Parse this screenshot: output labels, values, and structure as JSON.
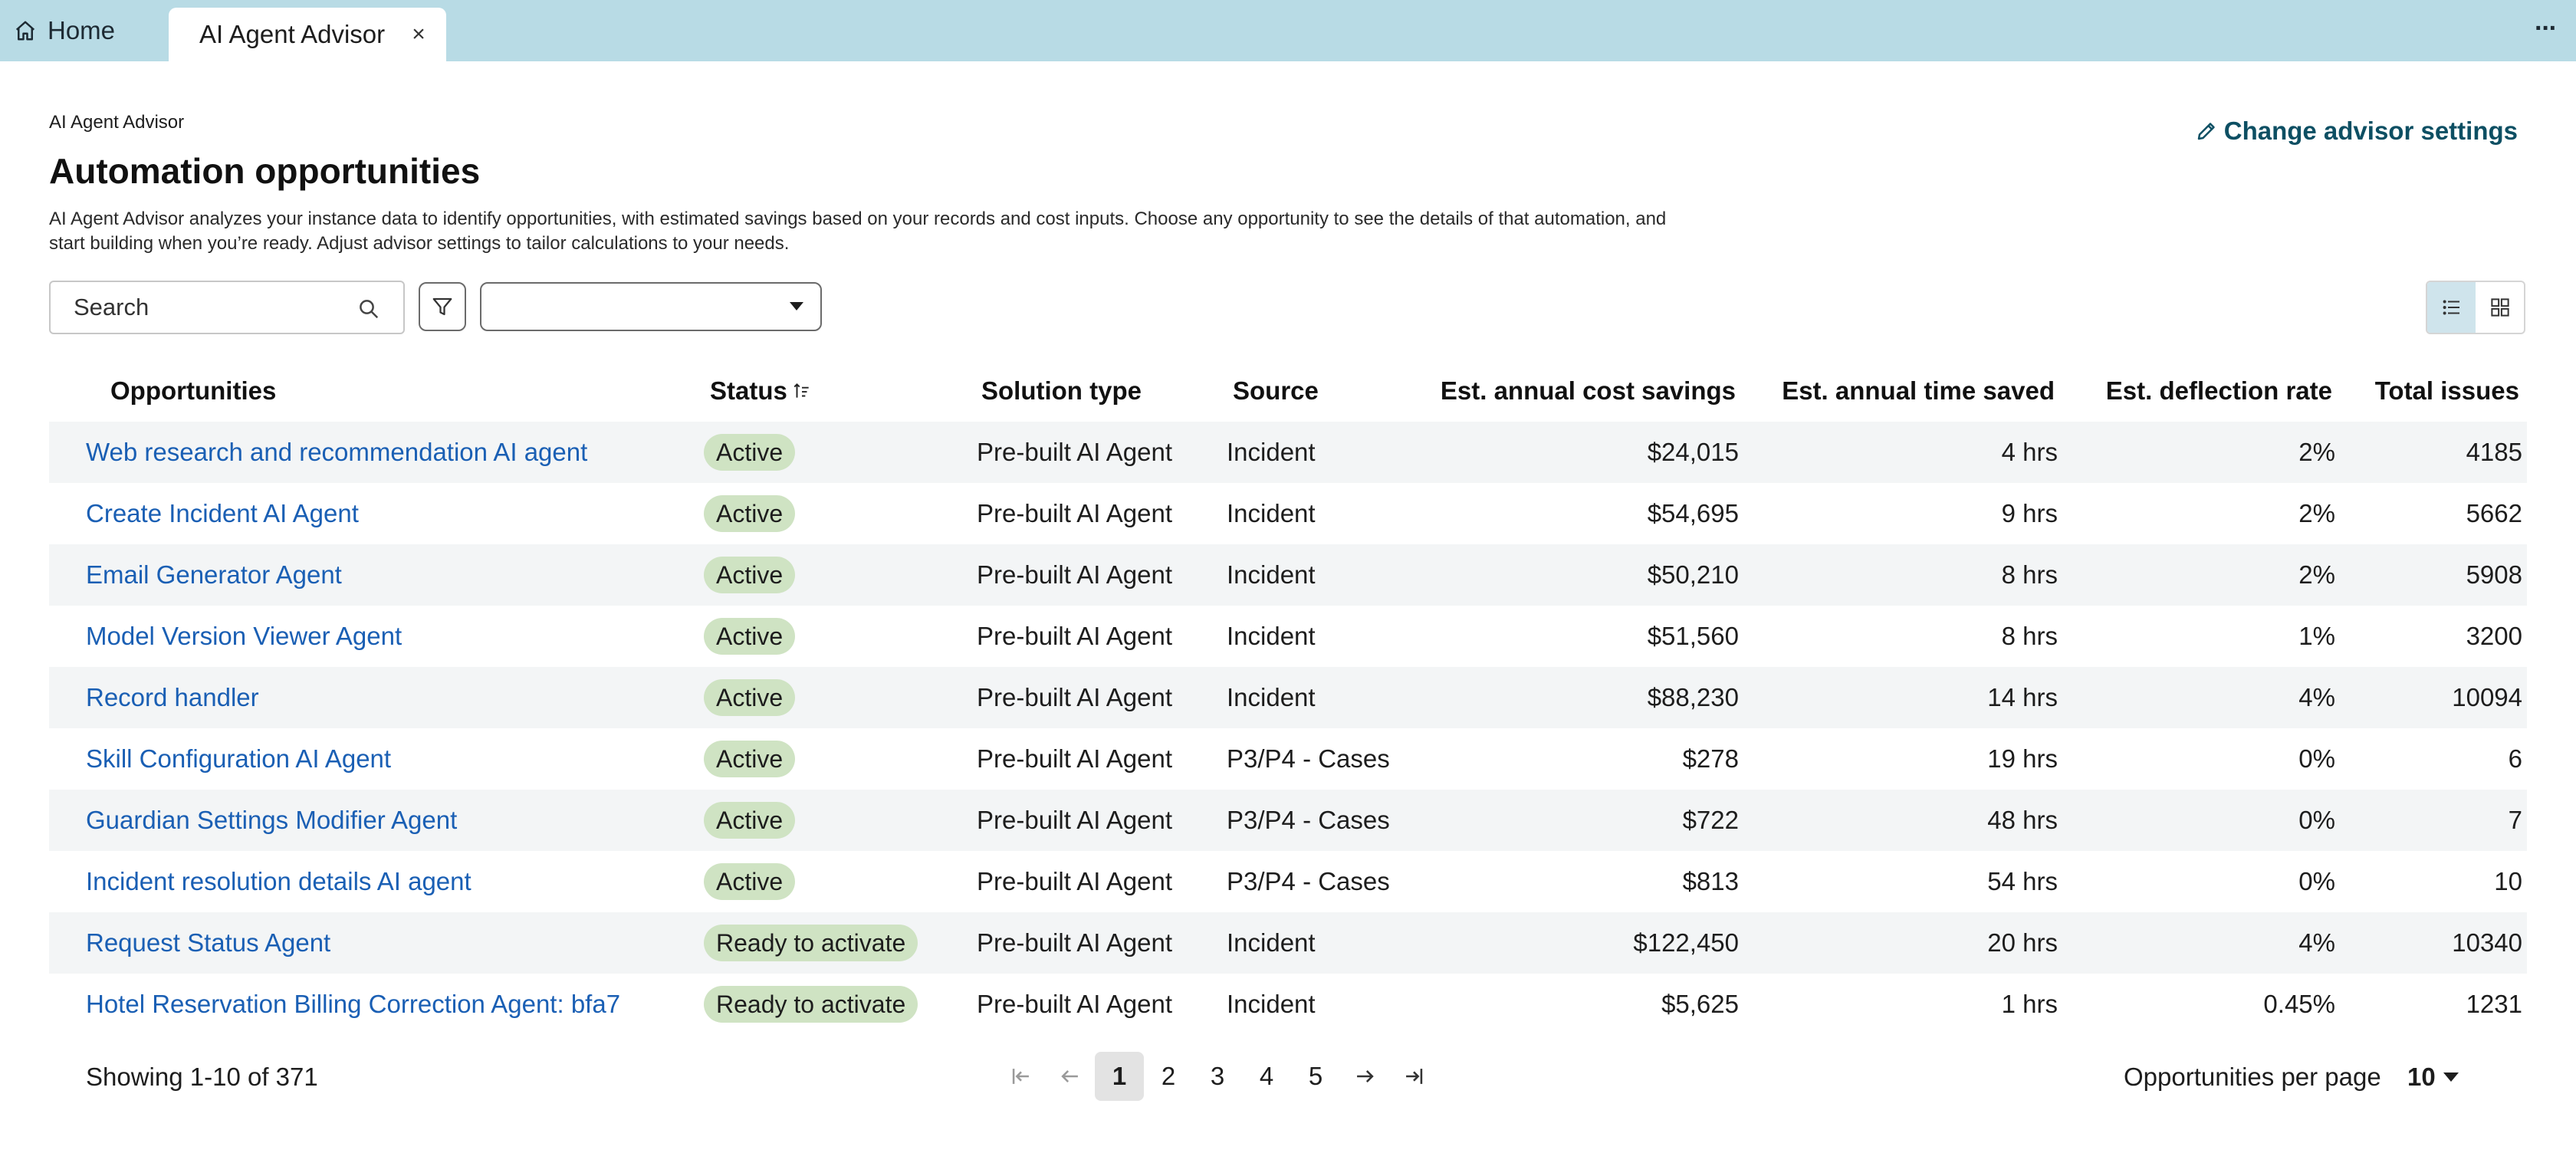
{
  "tabs": {
    "home_label": "Home",
    "active_label": "AI Agent Advisor"
  },
  "header": {
    "breadcrumb": "AI Agent Advisor",
    "title": "Automation opportunities",
    "description": "AI Agent Advisor analyzes your instance data to identify opportunities, with estimated savings based on your records and cost inputs. Choose any opportunity to see the details of that automation, and start building when you’re ready. Adjust advisor settings to tailor calculations to your needs.",
    "settings_link": "Change advisor settings"
  },
  "toolbar": {
    "search_placeholder": "Search",
    "select_value": ""
  },
  "table": {
    "columns": {
      "opportunities": "Opportunities",
      "status": "Status",
      "solution_type": "Solution type",
      "source": "Source",
      "cost_savings": "Est. annual cost savings",
      "time_saved": "Est. annual time saved",
      "deflection_rate": "Est. deflection rate",
      "total_issues": "Total issues"
    },
    "rows": [
      {
        "name": "Web research and recommendation AI agent",
        "status": "Active",
        "solution": "Pre-built AI Agent",
        "source": "Incident",
        "cost": "$24,015",
        "time": "4 hrs",
        "deflection": "2%",
        "issues": "4185"
      },
      {
        "name": "Create Incident AI Agent",
        "status": "Active",
        "solution": "Pre-built AI Agent",
        "source": "Incident",
        "cost": "$54,695",
        "time": "9 hrs",
        "deflection": "2%",
        "issues": "5662"
      },
      {
        "name": "Email Generator Agent",
        "status": "Active",
        "solution": "Pre-built AI Agent",
        "source": "Incident",
        "cost": "$50,210",
        "time": "8 hrs",
        "deflection": "2%",
        "issues": "5908"
      },
      {
        "name": "Model Version Viewer Agent",
        "status": "Active",
        "solution": "Pre-built AI Agent",
        "source": "Incident",
        "cost": "$51,560",
        "time": "8 hrs",
        "deflection": "1%",
        "issues": "3200"
      },
      {
        "name": "Record handler",
        "status": "Active",
        "solution": "Pre-built AI Agent",
        "source": "Incident",
        "cost": "$88,230",
        "time": "14 hrs",
        "deflection": "4%",
        "issues": "10094"
      },
      {
        "name": "Skill Configuration AI Agent",
        "status": "Active",
        "solution": "Pre-built AI Agent",
        "source": "P3/P4 - Cases",
        "cost": "$278",
        "time": "19 hrs",
        "deflection": "0%",
        "issues": "6"
      },
      {
        "name": "Guardian Settings Modifier Agent",
        "status": "Active",
        "solution": "Pre-built AI Agent",
        "source": "P3/P4 - Cases",
        "cost": "$722",
        "time": "48 hrs",
        "deflection": "0%",
        "issues": "7"
      },
      {
        "name": "Incident resolution details AI agent",
        "status": "Active",
        "solution": "Pre-built AI Agent",
        "source": "P3/P4 - Cases",
        "cost": "$813",
        "time": "54 hrs",
        "deflection": "0%",
        "issues": "10"
      },
      {
        "name": "Request Status Agent",
        "status": "Ready to activate",
        "solution": "Pre-built AI Agent",
        "source": "Incident",
        "cost": "$122,450",
        "time": "20 hrs",
        "deflection": "4%",
        "issues": "10340"
      },
      {
        "name": "Hotel Reservation Billing Correction Agent: bfa7",
        "status": "Ready to activate",
        "solution": "Pre-built AI Agent",
        "source": "Incident",
        "cost": "$5,625",
        "time": "1 hrs",
        "deflection": "0.45%",
        "issues": "1231"
      }
    ]
  },
  "footer": {
    "showing": "Showing 1-10 of 371",
    "pages": [
      "1",
      "2",
      "3",
      "4",
      "5"
    ],
    "current_page": "1",
    "per_page_label": "Opportunities per page",
    "per_page_value": "10"
  },
  "colors": {
    "tabbar": "#b8dbe5",
    "link": "#1a5fb4",
    "settings_link": "#0d4f63",
    "status_badge": "#cfe3c3",
    "row_alt": "#f3f5f6"
  }
}
